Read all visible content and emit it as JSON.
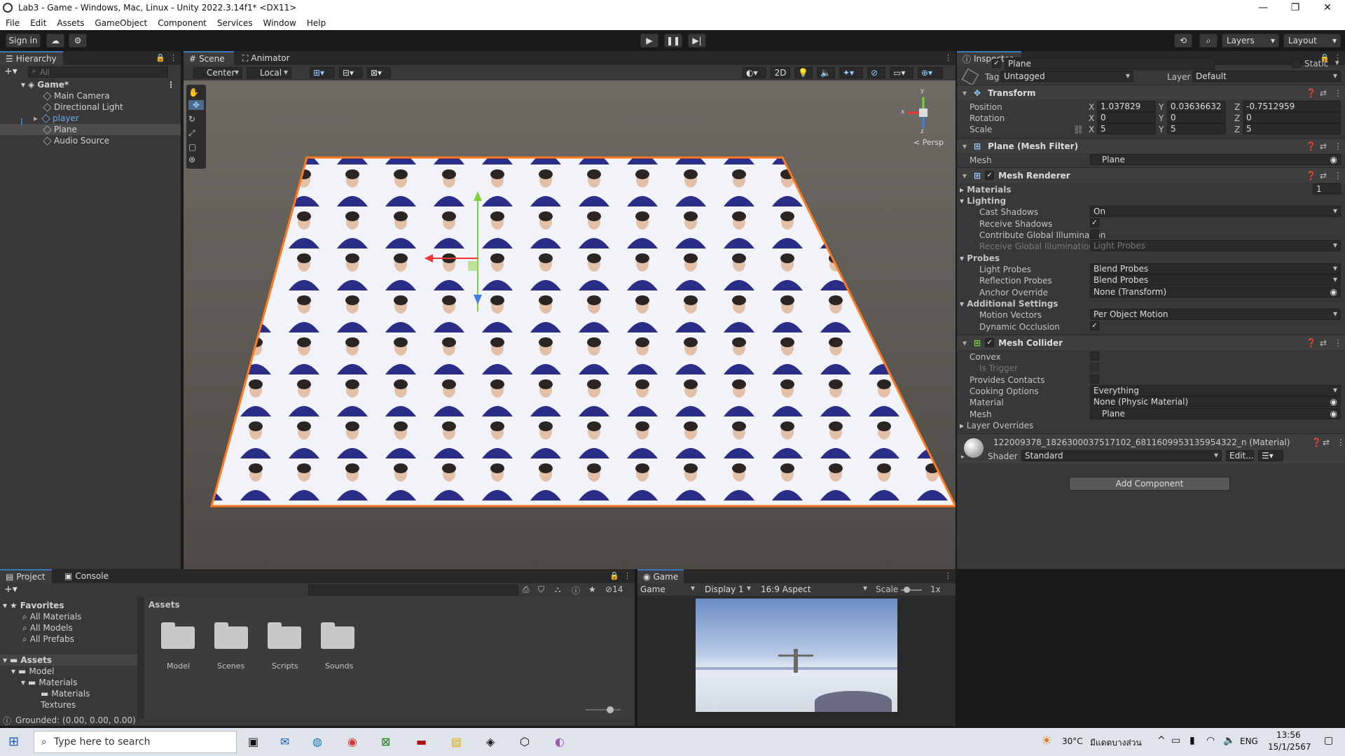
{
  "window": {
    "title": "Lab3 - Game - Windows, Mac, Linux - Unity 2022.3.14f1* <DX11>",
    "minimize": "—",
    "maximize": "❐",
    "close": "✕"
  },
  "menu": [
    "File",
    "Edit",
    "Assets",
    "GameObject",
    "Component",
    "Services",
    "Window",
    "Help"
  ],
  "toolbar": {
    "sign_in": "Sign in",
    "layers": "Layers",
    "layout": "Layout"
  },
  "hierarchy": {
    "tab": "Hierarchy",
    "search_placeholder": "All",
    "scene": "Game*",
    "items": [
      "Main Camera",
      "Directional Light",
      "player",
      "Plane",
      "Audio Source"
    ]
  },
  "scene_view": {
    "tabs": [
      "Scene",
      "Animator"
    ],
    "pivot": "Center",
    "space": "Local",
    "mode_2d": "2D",
    "persp": "< Persp",
    "gizmo_axes": {
      "y": "y",
      "x": "x",
      "z": "z"
    }
  },
  "inspector": {
    "tab": "Inspector",
    "object_name": "Plane",
    "static_label": "Static",
    "tag_label": "Tag",
    "tag_value": "Untagged",
    "layer_label": "Layer",
    "layer_value": "Default",
    "transform": {
      "title": "Transform",
      "position_label": "Position",
      "rotation_label": "Rotation",
      "scale_label": "Scale",
      "position": {
        "x": "1.037829",
        "y": "0.03636632",
        "z": "-0.7512959"
      },
      "rotation": {
        "x": "0",
        "y": "0",
        "z": "0"
      },
      "scale": {
        "x": "5",
        "y": "5",
        "z": "5"
      }
    },
    "mesh_filter": {
      "title": "Plane (Mesh Filter)",
      "mesh_label": "Mesh",
      "mesh_value": "Plane"
    },
    "mesh_renderer": {
      "title": "Mesh Renderer",
      "materials_label": "Materials",
      "materials_count": "1",
      "lighting_label": "Lighting",
      "cast_shadows_label": "Cast Shadows",
      "cast_shadows_value": "On",
      "receive_shadows_label": "Receive Shadows",
      "contribute_gi_label": "Contribute Global Illumination",
      "receive_gi_label": "Receive Global Illumination",
      "receive_gi_value": "Light Probes",
      "probes_label": "Probes",
      "light_probes_label": "Light Probes",
      "light_probes_value": "Blend Probes",
      "reflection_probes_label": "Reflection Probes",
      "reflection_probes_value": "Blend Probes",
      "anchor_override_label": "Anchor Override",
      "anchor_override_value": "None (Transform)",
      "additional_label": "Additional Settings",
      "motion_vectors_label": "Motion Vectors",
      "motion_vectors_value": "Per Object Motion",
      "dynamic_occlusion_label": "Dynamic Occlusion"
    },
    "mesh_collider": {
      "title": "Mesh Collider",
      "convex_label": "Convex",
      "is_trigger_label": "Is Trigger",
      "provides_contacts_label": "Provides Contacts",
      "cooking_label": "Cooking Options",
      "cooking_value": "Everything",
      "material_label": "Material",
      "material_value": "None (Physic Material)",
      "mesh_label": "Mesh",
      "mesh_value": "Plane"
    },
    "layer_overrides": "Layer Overrides",
    "material": {
      "name": "122009378_1826300037517102_6811609953135954322_n (Material)",
      "shader_label": "Shader",
      "shader_value": "Standard",
      "edit": "Edit..."
    },
    "add_component": "Add Component"
  },
  "project": {
    "tabs": [
      "Project",
      "Console"
    ],
    "favorites_label": "Favorites",
    "favorites": [
      "All Materials",
      "All Models",
      "All Prefabs"
    ],
    "assets_label": "Assets",
    "tree": [
      "Model",
      "Materials",
      "Materials",
      "Textures"
    ],
    "breadcrumb": "Assets",
    "folders": [
      "Model",
      "Scenes",
      "Scripts",
      "Sounds"
    ],
    "hidden_count": "14"
  },
  "game_view": {
    "tab": "Game",
    "mode": "Game",
    "display": "Display 1",
    "aspect": "16:9 Aspect",
    "scale_label": "Scale",
    "scale_value": "1x"
  },
  "status": "Grounded: (0.00, 0.00, 0.00)",
  "taskbar": {
    "search": "Type here to search",
    "temp": "30°C",
    "weather": "มีแดดบางส่วน",
    "lang": "ENG",
    "time": "13:56",
    "date": "15/1/2567"
  }
}
